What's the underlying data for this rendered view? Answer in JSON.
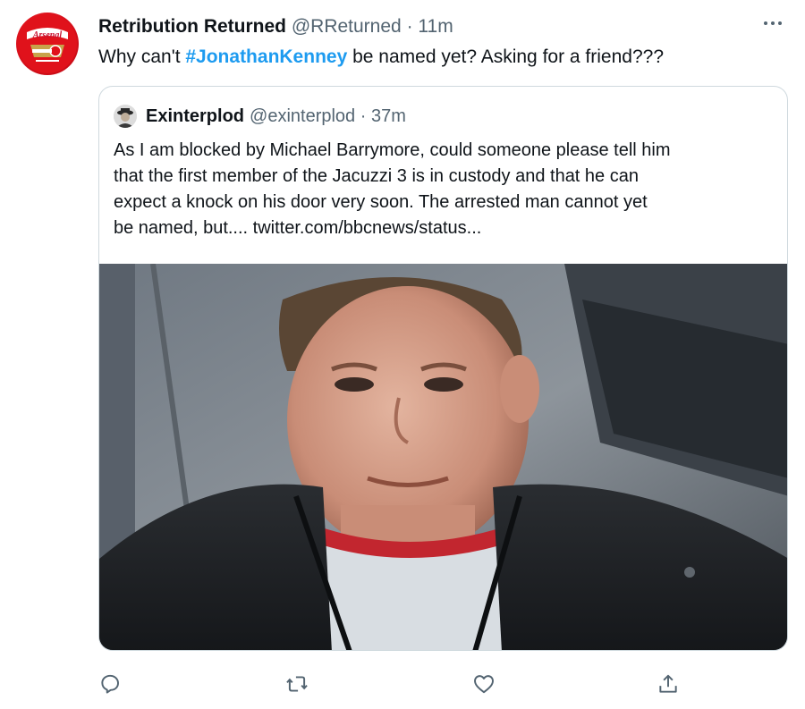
{
  "tweet": {
    "author_name": "Retribution Returned",
    "handle": "@RReturned",
    "separator": "·",
    "time": "11m",
    "text_before": "Why can't ",
    "hashtag": "#JonathanKenney",
    "text_after": " be named yet? Asking for a friend???",
    "avatar_text": "Arsenal",
    "more_icon": "more-horizontal-icon"
  },
  "quoted": {
    "author_name": "Exinterplod",
    "handle": "@exinterplod",
    "separator": "·",
    "time": "37m",
    "lines": [
      "As I am blocked by Michael Barrymore, could someone please tell him",
      "that the first member of the Jacuzzi 3 is in custody and that he can",
      "expect a knock on his door very soon. The arrested man cannot yet",
      "be named, but....  twitter.com/bbcnews/status..."
    ]
  },
  "actions": [
    "reply-icon",
    "retweet-icon",
    "like-icon",
    "share-icon"
  ],
  "colors": {
    "accent": "#1d9bf0",
    "muted": "#536471",
    "border": "#cfd9de"
  }
}
